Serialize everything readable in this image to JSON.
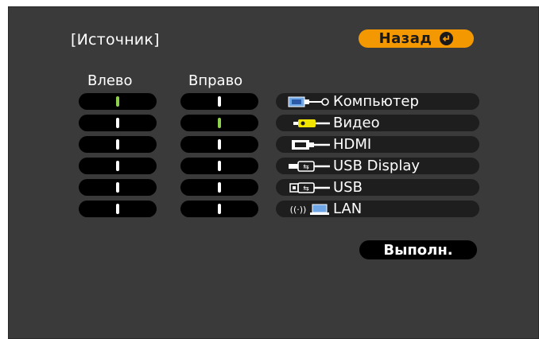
{
  "title": "[Источник]",
  "back_button": {
    "label": "Назад",
    "icon": "enter-icon"
  },
  "columns": {
    "left": "Влево",
    "right": "Вправо"
  },
  "left_slots": [
    {
      "active": true
    },
    {
      "active": false
    },
    {
      "active": false
    },
    {
      "active": false
    },
    {
      "active": false
    },
    {
      "active": false
    }
  ],
  "right_slots": [
    {
      "active": false
    },
    {
      "active": true
    },
    {
      "active": false
    },
    {
      "active": false
    },
    {
      "active": false
    },
    {
      "active": false
    }
  ],
  "sources": [
    {
      "label": "Компьютер",
      "icon": "computer-cable-icon"
    },
    {
      "label": "Видео",
      "icon": "video-cable-icon"
    },
    {
      "label": "HDMI",
      "icon": "hdmi-cable-icon"
    },
    {
      "label": "USB Display",
      "icon": "usb-display-cable-icon"
    },
    {
      "label": "USB",
      "icon": "usb-cable-icon"
    },
    {
      "label": "LAN",
      "icon": "lan-wireless-icon"
    }
  ],
  "execute_button": {
    "label": "Выполн."
  },
  "colors": {
    "background": "#3a3a3a",
    "accent": "#f39800",
    "active_indicator": "#8fd14f",
    "slot": "#000000"
  }
}
